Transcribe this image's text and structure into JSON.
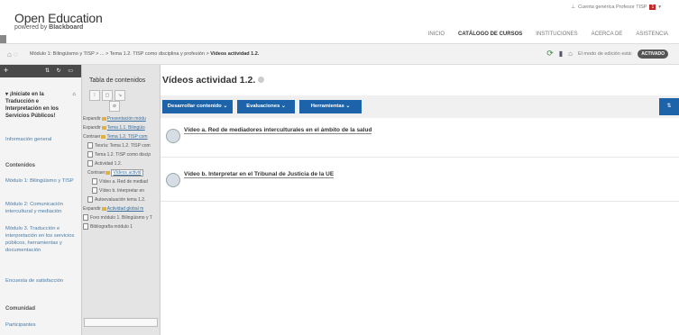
{
  "header": {
    "logo_title": "Open Education",
    "logo_powered": "powered by",
    "logo_brand": "Blackboard",
    "user_text": "Cuenta genérica Profesor TISP",
    "user_badge": "1",
    "nav": [
      "INICIO",
      "CATÁLOGO DE CURSOS",
      "INSTITUCIONES",
      "ACERCA DE",
      "ASISTENCIA"
    ]
  },
  "breadcrumb": {
    "path": "Módulo 1: Bilingüismo y TISP > ... > Tema 1.2. TISP como disciplina y profesión >",
    "current": "Vídeos actividad 1.2.",
    "edit_mode_label": "El modo de edición está:",
    "edit_mode_value": "ACTIVADO"
  },
  "sidebar": {
    "course_title": "¡Iniciate en la Traducción e Interpretación en los Servicios Públicos!",
    "items": [
      "Información general",
      "Contenidos",
      "Módulo 1: Bilingüismo y TISP",
      "Módulo 2: Comunicación intercultural y mediación",
      "Módulo 3. Traducción e interpretación en los servicios públicos, herramientas y documentación",
      "Encuesta de satisfacción",
      "Comunidad",
      "Participantes"
    ]
  },
  "toc": {
    "title": "Tabla de contenidos",
    "tree": [
      {
        "prefix": "Expandir",
        "text": "Presentación módu",
        "link": true
      },
      {
        "prefix": "Expandir",
        "text": "Tema 1.1. Bilingüis",
        "link": true
      },
      {
        "prefix": "Contraer",
        "text": "Tema 1.2. TISP com",
        "link": true
      },
      {
        "prefix": "",
        "text": "Teoría: Tema 1.2. TISP com",
        "link": false
      },
      {
        "prefix": "",
        "text": "Tema 1.2. TISP como discip",
        "link": false
      },
      {
        "prefix": "",
        "text": "Actividad 1.2.",
        "link": false
      },
      {
        "prefix": "Contraer",
        "text": "Vídeos activid",
        "link": true
      },
      {
        "prefix": "",
        "text": "Vídeo a. Red de mediad",
        "link": false
      },
      {
        "prefix": "",
        "text": "Vídeo b. Interpretar en",
        "link": false
      },
      {
        "prefix": "",
        "text": "Autoevaluación tema 1.2.",
        "link": false
      },
      {
        "prefix": "Expandir",
        "text": "Actividad global m",
        "link": true
      },
      {
        "prefix": "",
        "text": "Foro módulo 1. Bilingüismo y T",
        "link": false
      },
      {
        "prefix": "",
        "text": "Bibliografía módulo 1",
        "link": false
      }
    ]
  },
  "main": {
    "title": "Vídeos actividad 1.2.",
    "buttons": [
      "Desarrollar contenido",
      "Evaluaciones",
      "Herramientas"
    ],
    "items": [
      "Vídeo a. Red de mediadores interculturales en el ámbito de la salud",
      "Vídeo b. Interpretar en el Tribunal de Justicia de la UE"
    ]
  }
}
